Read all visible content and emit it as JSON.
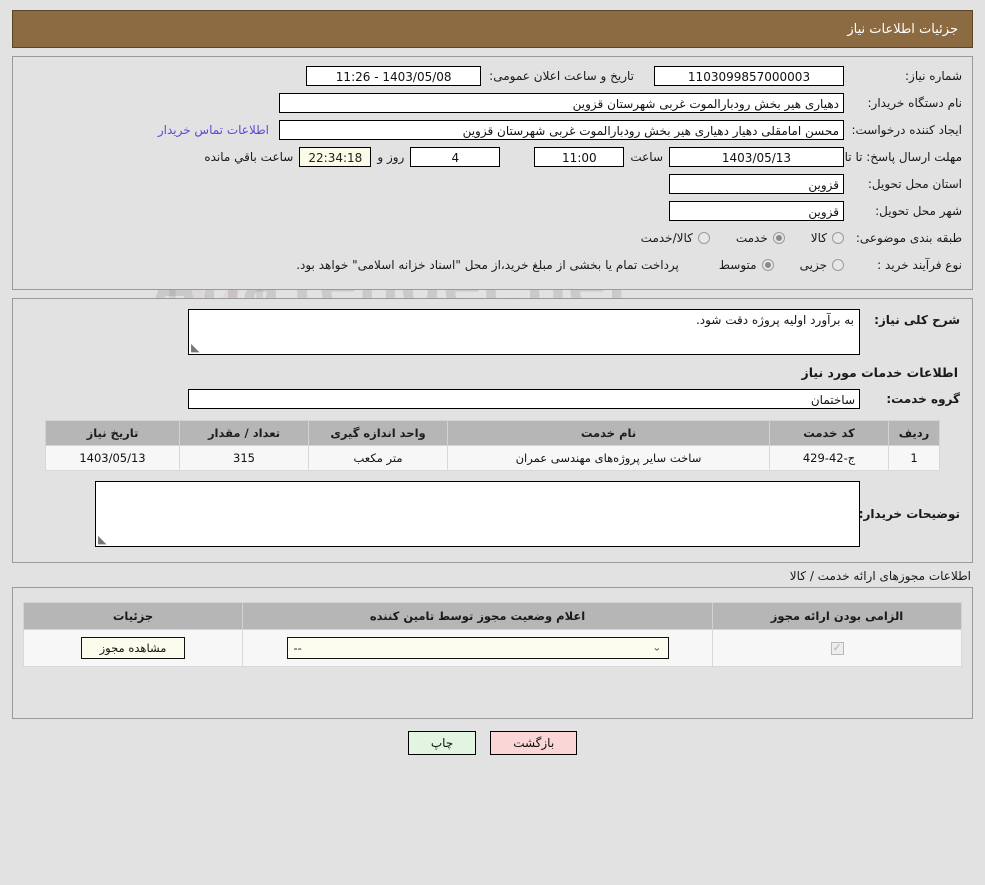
{
  "header": {
    "title": "جزئیات اطلاعات نیاز"
  },
  "watermark": {
    "text": "AnaTender.net",
    "icon": "shield-icon"
  },
  "summary": {
    "need_number_label": "شماره نیاز:",
    "need_number_value": "1103099857000003",
    "announce_datetime_label": "تاریخ و ساعت اعلان عمومی:",
    "announce_datetime_value": "1403/05/08 - 11:26",
    "buyer_org_label": "نام دستگاه خریدار:",
    "buyer_org_value": "دهیاری هیر بخش رودبارالموت غربی شهرستان قزوین",
    "requester_label": "ایجاد کننده درخواست:",
    "requester_value": "محسن امامقلی دهیار دهیاری هیر بخش رودبارالموت غربی شهرستان قزوین",
    "contact_link": "اطلاعات تماس خریدار",
    "deadline_label": "مهلت ارسال پاسخ: تا تاریخ:",
    "deadline_date": "1403/05/13",
    "deadline_hour_label": "ساعت",
    "deadline_hour": "11:00",
    "remaining_days": "4",
    "remaining_days_sep": "روز و",
    "remaining_time": "22:34:18",
    "remaining_suffix": "ساعت باقي مانده",
    "province_label": "استان محل تحویل:",
    "province_value": "قزوین",
    "city_label": "شهر محل تحویل:",
    "city_value": "قزوین",
    "category_label": "طبقه بندی موضوعی:",
    "category_options": [
      {
        "label": "کالا",
        "selected": false
      },
      {
        "label": "خدمت",
        "selected": true
      },
      {
        "label": "کالا/خدمت",
        "selected": false
      }
    ],
    "process_label": "نوع فرآیند خرید :",
    "process_options": [
      {
        "label": "جزیی",
        "selected": false
      },
      {
        "label": "متوسط",
        "selected": true
      }
    ],
    "process_note": "پرداخت تمام یا بخشی از مبلغ خرید،از محل \"اسناد خزانه اسلامی\" خواهد بود."
  },
  "details": {
    "general_desc_label": "شرح کلی نیاز:",
    "general_desc_value": "به برآورد اولیه پروژه دقت شود.",
    "services_title": "اطلاعات خدمات مورد نیاز",
    "service_group_label": "گروه خدمت:",
    "service_group_value": "ساختمان",
    "table": {
      "columns": [
        "ردیف",
        "کد خدمت",
        "نام خدمت",
        "واحد اندازه گیری",
        "تعداد / مقدار",
        "تاریخ نیاز"
      ],
      "rows": [
        {
          "row_no": "1",
          "service_code": "ج-42-429",
          "service_name": "ساخت سایر پروژه‌های مهندسی عمران",
          "unit": "متر مکعب",
          "quantity": "315",
          "need_date": "1403/05/13"
        }
      ]
    },
    "buyer_notes_label": "توضیحات خریدار:",
    "buyer_notes_value": ""
  },
  "permits": {
    "caption": "اطلاعات مجوزهای ارائه خدمت / کالا",
    "columns": [
      "الزامی بودن ارائه مجوز",
      "اعلام وضعیت مجوز توسط تامین کننده",
      "جزئیات"
    ],
    "rows": [
      {
        "required_checked": true,
        "status_value": "--",
        "details_button": "مشاهده مجوز"
      }
    ]
  },
  "footer": {
    "back_button": "بازگشت",
    "print_button": "چاپ"
  },
  "colors": {
    "header_bg": "#8c6b43",
    "page_bg": "#e2e2e2",
    "link": "#5b4bd6",
    "table_header_bg": "#b6b6b6",
    "countdown_bg": "#fbfbe8",
    "back_btn_bg": "#fbd6d6",
    "print_btn_bg": "#e2f5e0"
  }
}
